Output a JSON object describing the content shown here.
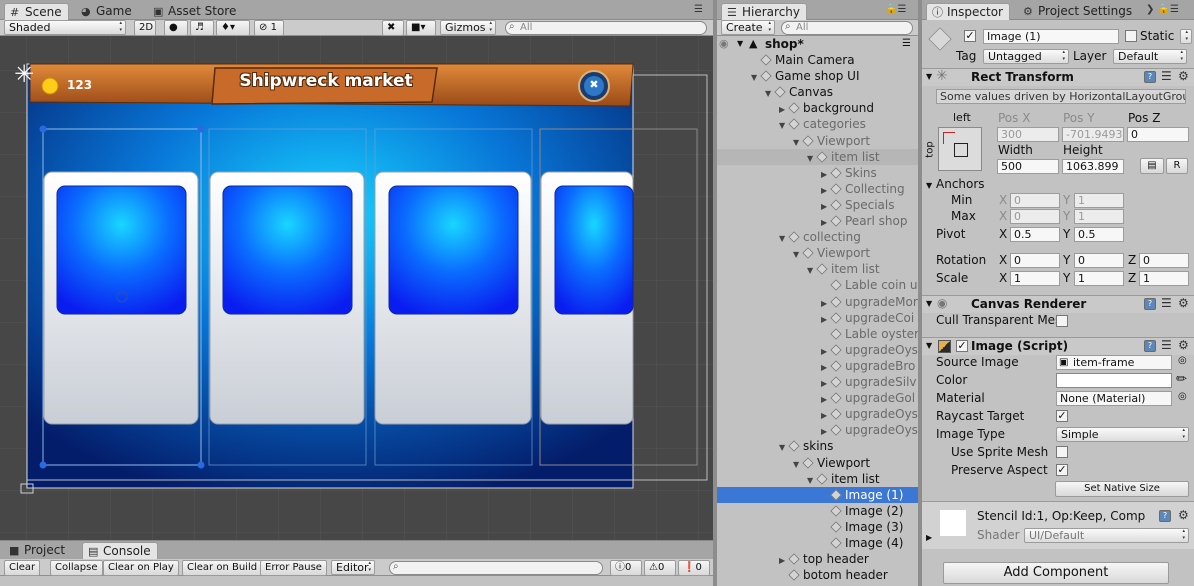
{
  "scene_window": {
    "tabs": [
      {
        "label": "Scene",
        "icon": "hash-icon",
        "active": true
      },
      {
        "label": "Game",
        "icon": "pacman-icon",
        "active": false
      },
      {
        "label": "Asset Store",
        "icon": "store-icon",
        "active": false
      }
    ],
    "toolbar": {
      "shading_mode": "Shaded",
      "mode_2d": "2D",
      "hidden_layers_count": "1",
      "gizmos": "Gizmos",
      "search_placeholder": "All"
    },
    "game_ui": {
      "coin_count": "123",
      "title": "Shipwreck market",
      "close_glyph": "✖",
      "cards_count": 4,
      "accent_colors": {
        "board": "#c46a2a",
        "banner_bg": "#0aa8e8",
        "card_image": "#0a3cff"
      }
    }
  },
  "bottom_panel": {
    "tabs": [
      {
        "label": "Project",
        "active": false
      },
      {
        "label": "Console",
        "active": true
      }
    ],
    "buttons": [
      "Clear",
      "Collapse",
      "Clear on Play",
      "Clear on Build",
      "Error Pause"
    ],
    "editor_dropdown": "Editor",
    "counts": {
      "messages": "0",
      "warnings": "0",
      "errors": "0"
    }
  },
  "hierarchy": {
    "tab_label": "Hierarchy",
    "create_label": "Create",
    "search_placeholder": "All",
    "scene_name": "shop*",
    "items": [
      {
        "label": "Main Camera",
        "depth": 1,
        "arrow": "",
        "grey": false,
        "selected": false
      },
      {
        "label": "Game shop UI",
        "depth": 1,
        "arrow": "▼",
        "grey": false,
        "selected": false
      },
      {
        "label": "Canvas",
        "depth": 2,
        "arrow": "▼",
        "grey": false,
        "selected": false
      },
      {
        "label": "background",
        "depth": 3,
        "arrow": "▶",
        "grey": false,
        "selected": false
      },
      {
        "label": "categories",
        "depth": 3,
        "arrow": "▼",
        "grey": true,
        "selected": false
      },
      {
        "label": "Viewport",
        "depth": 4,
        "arrow": "▼",
        "grey": true,
        "selected": false
      },
      {
        "label": "item list",
        "depth": 5,
        "arrow": "▼",
        "grey": true,
        "selected": false,
        "hover": true
      },
      {
        "label": "Skins",
        "depth": 6,
        "arrow": "▶",
        "grey": true,
        "selected": false
      },
      {
        "label": "Collecting",
        "depth": 6,
        "arrow": "▶",
        "grey": true,
        "selected": false
      },
      {
        "label": "Specials",
        "depth": 6,
        "arrow": "▶",
        "grey": true,
        "selected": false
      },
      {
        "label": "Pearl shop",
        "depth": 6,
        "arrow": "▶",
        "grey": true,
        "selected": false
      },
      {
        "label": "collecting",
        "depth": 3,
        "arrow": "▼",
        "grey": true,
        "selected": false
      },
      {
        "label": "Viewport",
        "depth": 4,
        "arrow": "▼",
        "grey": true,
        "selected": false
      },
      {
        "label": "item list",
        "depth": 5,
        "arrow": "▼",
        "grey": true,
        "selected": false
      },
      {
        "label": "Lable coin u",
        "depth": 6,
        "arrow": "",
        "grey": true,
        "selected": false
      },
      {
        "label": "upgradeMor",
        "depth": 6,
        "arrow": "▶",
        "grey": true,
        "selected": false
      },
      {
        "label": "upgradeCoi",
        "depth": 6,
        "arrow": "▶",
        "grey": true,
        "selected": false
      },
      {
        "label": "Lable oyster",
        "depth": 6,
        "arrow": "",
        "grey": true,
        "selected": false
      },
      {
        "label": "upgradeOys",
        "depth": 6,
        "arrow": "▶",
        "grey": true,
        "selected": false
      },
      {
        "label": "upgradeBro",
        "depth": 6,
        "arrow": "▶",
        "grey": true,
        "selected": false
      },
      {
        "label": "upgradeSilv",
        "depth": 6,
        "arrow": "▶",
        "grey": true,
        "selected": false
      },
      {
        "label": "upgradeGol",
        "depth": 6,
        "arrow": "▶",
        "grey": true,
        "selected": false
      },
      {
        "label": "upgradeOys",
        "depth": 6,
        "arrow": "▶",
        "grey": true,
        "selected": false
      },
      {
        "label": "upgradeOys",
        "depth": 6,
        "arrow": "▶",
        "grey": true,
        "selected": false
      },
      {
        "label": "skins",
        "depth": 3,
        "arrow": "▼",
        "grey": false,
        "selected": false
      },
      {
        "label": "Viewport",
        "depth": 4,
        "arrow": "▼",
        "grey": false,
        "selected": false
      },
      {
        "label": "item list",
        "depth": 5,
        "arrow": "▼",
        "grey": false,
        "selected": false
      },
      {
        "label": "Image (1)",
        "depth": 6,
        "arrow": "",
        "grey": false,
        "selected": true
      },
      {
        "label": "Image (2)",
        "depth": 6,
        "arrow": "",
        "grey": false,
        "selected": false
      },
      {
        "label": "Image (3)",
        "depth": 6,
        "arrow": "",
        "grey": false,
        "selected": false
      },
      {
        "label": "Image (4)",
        "depth": 6,
        "arrow": "",
        "grey": false,
        "selected": false
      },
      {
        "label": "top header",
        "depth": 3,
        "arrow": "▶",
        "grey": false,
        "selected": false
      },
      {
        "label": "botom header",
        "depth": 3,
        "arrow": "",
        "grey": false,
        "selected": false
      }
    ]
  },
  "inspector": {
    "tabs": [
      {
        "label": "Inspector",
        "active": true
      },
      {
        "label": "Project Settings",
        "active": false
      }
    ],
    "object_name": "Image (1)",
    "static_label": "Static",
    "tag_label": "Tag",
    "tag_value": "Untagged",
    "layer_label": "Layer",
    "layer_value": "Default",
    "rect_transform": {
      "title": "Rect Transform",
      "driven_note": "Some values driven by HorizontalLayoutGroup.",
      "anchor_h": "left",
      "anchor_v": "top",
      "pos_x_label": "Pos X",
      "pos_x": "300",
      "pos_y_label": "Pos Y",
      "pos_y": "-701.9493",
      "pos_z_label": "Pos Z",
      "pos_z": "0",
      "width_label": "Width",
      "width": "500",
      "height_label": "Height",
      "height": "1063.899",
      "r_button": "R",
      "anchors_label": "Anchors",
      "min_label": "Min",
      "min_x": "0",
      "min_y": "1",
      "max_label": "Max",
      "max_x": "0",
      "max_y": "1",
      "pivot_label": "Pivot",
      "pivot_x": "0.5",
      "pivot_y": "0.5",
      "rotation_label": "Rotation",
      "rot_x": "0",
      "rot_y": "0",
      "rot_z": "0",
      "scale_label": "Scale",
      "scale_x": "1",
      "scale_y": "1",
      "scale_z": "1",
      "x": "X",
      "y": "Y",
      "z": "Z"
    },
    "canvas_renderer": {
      "title": "Canvas Renderer",
      "cull_label": "Cull Transparent Mes"
    },
    "image_script": {
      "title": "Image (Script)",
      "source_image_label": "Source Image",
      "source_image": "item-frame",
      "color_label": "Color",
      "material_label": "Material",
      "material": "None (Material)",
      "raycast_label": "Raycast Target",
      "image_type_label": "Image Type",
      "image_type": "Simple",
      "use_sprite_mesh_label": "Use Sprite Mesh",
      "preserve_aspect_label": "Preserve Aspect",
      "set_native_size": "Set Native Size"
    },
    "material_preview": {
      "name": "Stencil Id:1, Op:Keep, Comp",
      "shader_label": "Shader",
      "shader": "UI/Default"
    },
    "add_component": "Add Component"
  }
}
